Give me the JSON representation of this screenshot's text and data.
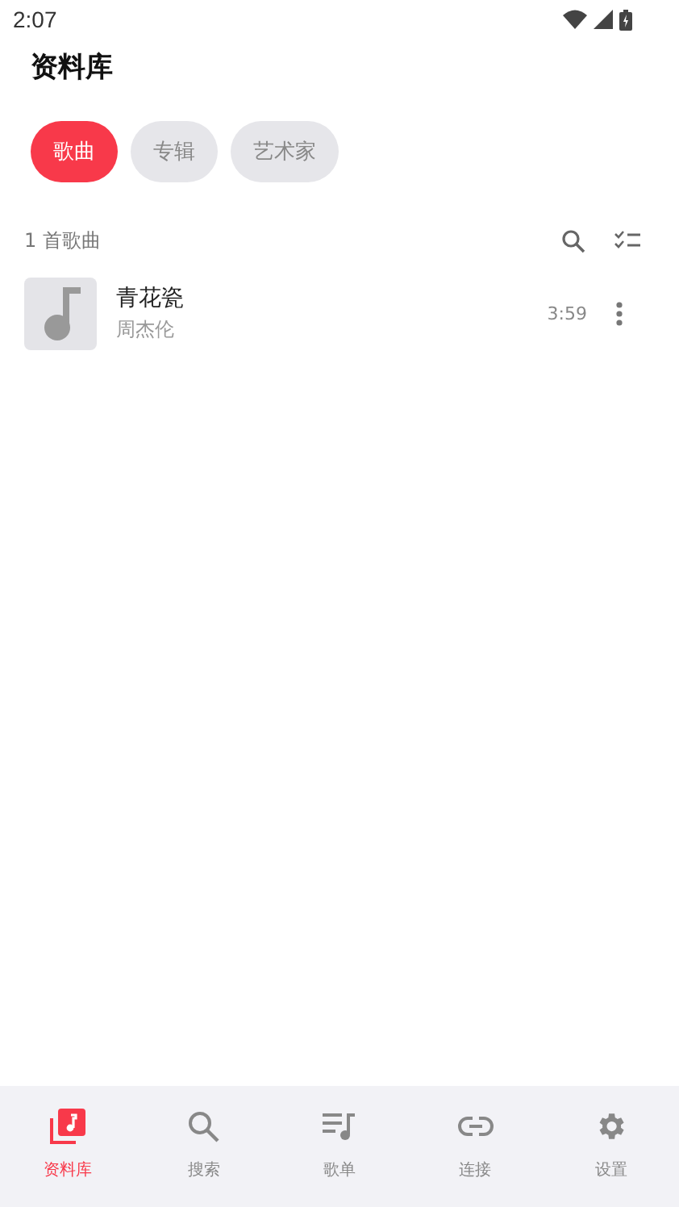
{
  "status_bar": {
    "time": "2:07"
  },
  "title": "资料库",
  "chips": [
    {
      "label": "歌曲",
      "selected": true
    },
    {
      "label": "专辑",
      "selected": false
    },
    {
      "label": "艺术家",
      "selected": false
    }
  ],
  "list_header": {
    "count": "1 首歌曲"
  },
  "songs": [
    {
      "title": "青花瓷",
      "artist": "周杰伦",
      "duration": "3:59"
    }
  ],
  "nav": [
    {
      "label": "资料库",
      "selected": true
    },
    {
      "label": "搜索",
      "selected": false
    },
    {
      "label": "歌单",
      "selected": false
    },
    {
      "label": "连接",
      "selected": false
    },
    {
      "label": "设置",
      "selected": false
    }
  ]
}
